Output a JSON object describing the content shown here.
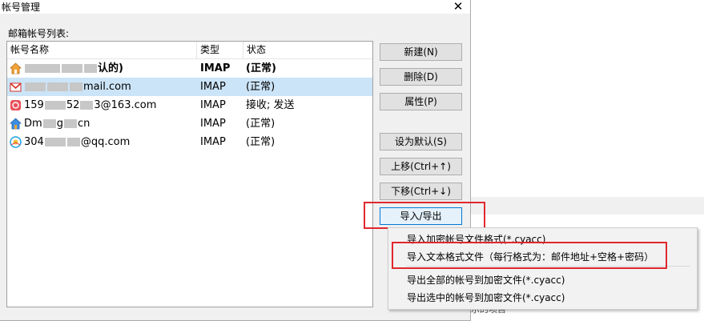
{
  "dialog": {
    "title": "帐号管理",
    "close_glyph": "✕",
    "list_label": "邮箱帐号列表:"
  },
  "columns": {
    "name": "帐号名称",
    "type": "类型",
    "status": "状态"
  },
  "accounts": [
    {
      "name_pre": "",
      "name_post": "认的)",
      "type": "IMAP",
      "status": "(正常)",
      "icon": "house-icon"
    },
    {
      "name_pre": "",
      "name_post": "mail.com",
      "type": "IMAP",
      "status": "(正常)",
      "icon": "gmail-icon"
    },
    {
      "name_pre": "159",
      "name_mid": "52",
      "name_post": "3@163.com",
      "type": "IMAP",
      "status": "接收; 发送",
      "icon": "netease-163-icon"
    },
    {
      "name_pre": "Dm",
      "name_mid": "g",
      "name_post": "cn",
      "type": "IMAP",
      "status": "(正常)",
      "icon": "house-icon"
    },
    {
      "name_pre": "304",
      "name_post": "@qq.com",
      "type": "IMAP",
      "status": "(正常)",
      "icon": "qq-mail-icon"
    }
  ],
  "buttons": {
    "new": "新建(N)",
    "delete": "删除(D)",
    "properties": "属性(P)",
    "set_default": "设为默认(S)",
    "move_up": "上移(Ctrl+↑)",
    "move_down": "下移(Ctrl+↓)",
    "import_export": "导入/导出"
  },
  "menu": {
    "items": [
      "导入加密帐号文件格式(*.cyacc)",
      "导入文本格式文件（每行格式为：邮件地址+空格+密码）",
      "导出全部的帐号到加密文件(*.cyacc)",
      "导出选中的帐号到加密文件(*.cyacc)"
    ]
  },
  "background": {
    "partial_text": "示的项目"
  },
  "colors": {
    "selection": "#cce4f7",
    "highlight_box": "#e0282e",
    "button_face": "#e1e1e1"
  }
}
